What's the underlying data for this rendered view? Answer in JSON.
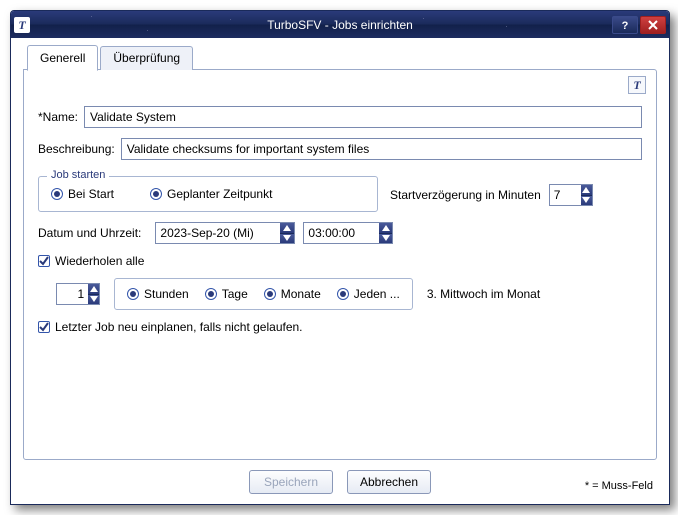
{
  "window": {
    "title": "TurboSFV - Jobs einrichten",
    "app_icon_letter": "T"
  },
  "tabs": {
    "general": "Generell",
    "verify": "Überprüfung"
  },
  "labels": {
    "name": "*Name:",
    "description": "Beschreibung:",
    "job_start_legend": "Job starten",
    "at_start": "Bei Start",
    "scheduled": "Geplanter Zeitpunkt",
    "start_delay": "Startverzögerung in Minuten",
    "date_time": "Datum und Uhrzeit:",
    "repeat_every": "Wiederholen alle",
    "hours": "Stunden",
    "days": "Tage",
    "months": "Monate",
    "every": "Jeden ...",
    "schedule_hint": "3. Mittwoch im Monat",
    "reschedule": "Letzter Job neu einplanen, falls nicht gelaufen.",
    "muss_feld": "* = Muss-Feld"
  },
  "values": {
    "name": "Validate System",
    "description": "Validate checksums for important system files",
    "start_delay": "7",
    "date": "2023-Sep-20 (Mi)",
    "time": "03:00:00",
    "repeat_count": "1"
  },
  "buttons": {
    "save": "Speichern",
    "cancel": "Abbrechen"
  }
}
